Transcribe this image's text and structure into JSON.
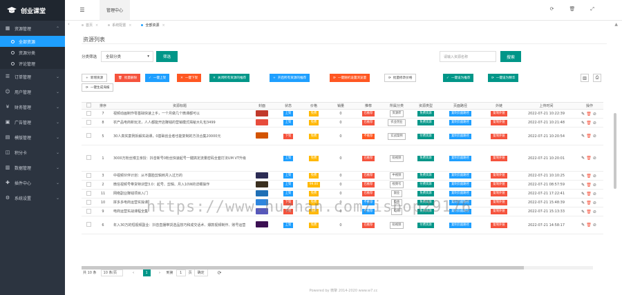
{
  "app": {
    "title": "创业课堂"
  },
  "sidebar": {
    "groups": [
      {
        "label": "资源管理",
        "icon": "grid-icon",
        "expanded": true,
        "children": [
          {
            "label": "全部资源",
            "active": true
          },
          {
            "label": "资源分类",
            "active": false
          },
          {
            "label": "评论管理",
            "active": false
          }
        ]
      },
      {
        "label": "订单管理",
        "icon": "list-icon"
      },
      {
        "label": "用户管理",
        "icon": "user-icon"
      },
      {
        "label": "财务管理",
        "icon": "money-icon"
      },
      {
        "label": "广告管理",
        "icon": "ad-icon"
      },
      {
        "label": "模版管理",
        "icon": "template-icon"
      },
      {
        "label": "积分卡",
        "icon": "card-icon"
      },
      {
        "label": "数据管理",
        "icon": "data-icon"
      },
      {
        "label": "插件中心",
        "icon": "plugin-icon"
      },
      {
        "label": "系统设置",
        "icon": "gear-icon"
      }
    ]
  },
  "topbar": {
    "admin": "管理中心"
  },
  "tabs": [
    {
      "label": "首页",
      "active": false
    },
    {
      "label": "系统配置",
      "active": false
    },
    {
      "label": "全部资源",
      "active": true
    }
  ],
  "panel": {
    "title": "资源列表",
    "filter_label": "分类筛选",
    "filter_value": "全部分类",
    "filter_button": "筛选",
    "search_placeholder": "请输入资源名称",
    "search_button": "搜索"
  },
  "toolbar": [
    "新增资源",
    "批量删除",
    "一键上架",
    "一键下架",
    "关闭所有资源的推荐",
    "开启所有资源的推荐",
    "一键随机设置浏览量",
    "批量修改价格",
    "一键设为推荐",
    "一键设为精华",
    "一键生成海报"
  ],
  "table": {
    "headers": [
      "",
      "排序",
      "资源标题",
      "封面",
      "状态",
      "价格",
      "销量",
      "推荐",
      "所属分类",
      "资源类型",
      "页面路径",
      "外链",
      "上传时间",
      "操作"
    ],
    "rows": [
      {
        "sort": "7",
        "title": "视频动画制作零基础快速上手，一个月做几个微课都可以",
        "cover": "#c0392b",
        "status": "上架",
        "price": "免费",
        "sales": "0",
        "rec": "已推荐",
        "cat": "资源库",
        "type": "免费资源",
        "path": "复制页面路径",
        "link": "复制外链",
        "time": "2022-07-21 10:22:39"
      },
      {
        "sort": "8",
        "title": "农产品电商新玩法，人人都能开店赚钱的营销模式揭秘大礼包3499",
        "cover": "#e74c3c",
        "status": "上架",
        "price": "免费",
        "sales": "0",
        "rec": "已推荐",
        "cat": "农业创业",
        "type": "免费资源",
        "path": "复制页面路径",
        "link": "复制外链",
        "time": "2022-07-21 10:21:48"
      },
      {
        "sort": "5",
        "title": "30人真实案例拆解实战课，0基础创业者也能复制的方法合集20000元",
        "cover": "#d35400",
        "status": "下架",
        "price": "免费",
        "sales": "0",
        "rec": "不推荐",
        "cat": "实战案例",
        "type": "付费资源",
        "path": "复制页面路径",
        "link": "复制外链",
        "time": "2022-07-21 10:20:54"
      },
      {
        "sort": "1",
        "title": "3000万粉丝博主亲授：抖音新号0粉丝快速起号一键搞定流量密码全套打法UM VT升级",
        "cover": "",
        "status": "上架",
        "price": "免费",
        "sales": "0",
        "rec": "已推荐",
        "cat": "短视频",
        "type": "免费资源",
        "path": "复制页面路径",
        "link": "复制外链",
        "time": "2022-07-21 10:20:01"
      },
      {
        "sort": "3",
        "title": "中视频伙伴计划：从不露脸剪辑到月入过万的",
        "cover": "#2c2c54",
        "status": "上架",
        "price": "免费",
        "sales": "0",
        "rec": "已推荐",
        "cat": "中视频",
        "type": "免费资源",
        "path": "复制页面路径",
        "link": "复制外链",
        "time": "2022-07-21 10:10:25"
      },
      {
        "sort": "2",
        "title": "微信视频号带货特训营3.0：起号、剪辑、月入10W的详细操作",
        "cover": "#3a2f1f",
        "status": "上架",
        "price": "99.00",
        "sales": "0",
        "rec": "已推荐",
        "cat": "视频号",
        "type": "付费资源",
        "path": "复制页面路径",
        "link": "复制外链",
        "time": "2022-07-21 08:57:59"
      },
      {
        "sort": "11",
        "title": "网络副业赚钱项目入门",
        "cover": "#1f6fb5",
        "status": "上架",
        "price": "免费",
        "sales": "0",
        "rec": "已推荐",
        "cat": "副业",
        "type": "免费资源",
        "path": "复制页面路径",
        "link": "复制外链",
        "time": "2022-07-21 17:22:41"
      },
      {
        "sort": "10",
        "title": "拼多多电商运营实操课",
        "cover": "#2e86de",
        "status": "下架",
        "price": "免费",
        "sales": "0",
        "rec": "不推荐",
        "cat": "电商",
        "type": "免费资源",
        "path": "复制页面路径",
        "link": "复制外链",
        "time": "2022-07-21 15:48:39"
      },
      {
        "sort": "9",
        "title": "电商运营实战课程全集",
        "cover": "#5758bb",
        "status": "下架",
        "price": "免费",
        "sales": "0",
        "rec": "不推荐",
        "cat": "电商",
        "type": "免费资源",
        "path": "复制页面路径",
        "link": "复制外链",
        "time": "2022-07-21 15:13:33"
      },
      {
        "sort": "6",
        "title": "年入30万的短视频副业：抖音直播带货选品技巧和成交话术、爆款视频制作、账号运营",
        "cover": "#3c1053",
        "status": "上架",
        "price": "免费",
        "sales": "0",
        "rec": "已推荐",
        "cat": "短视频",
        "type": "付费资源",
        "path": "复制页面路径",
        "link": "复制外链",
        "time": "2022-07-21 14:58:17"
      }
    ]
  },
  "pager": {
    "total": "共 10 条",
    "size": "10 条/页",
    "current": "1",
    "goto_label": "到第",
    "goto_value": "1",
    "page_unit": "页",
    "confirm": "确定"
  },
  "footer": "Powered by 微擎 2014-2020 www.w7.cc",
  "watermark": "https://www.huzhan.com/ishop29176"
}
